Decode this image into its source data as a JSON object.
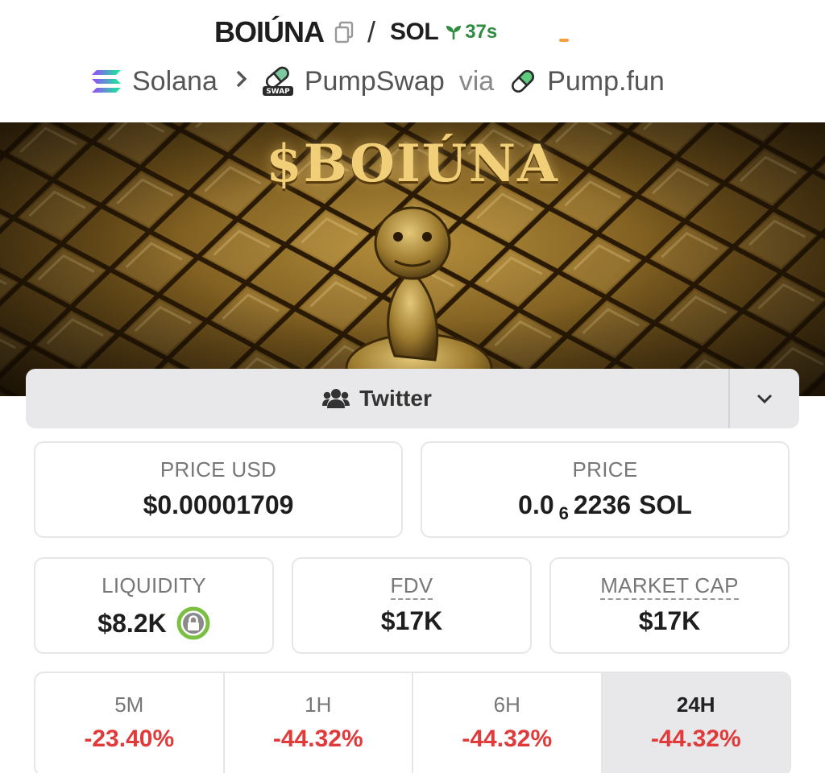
{
  "header": {
    "token_name": "BOIÚNA",
    "separator": "/",
    "quote_token": "SOL",
    "age": "37s"
  },
  "breadcrumb": {
    "chain": "Solana",
    "dex": "PumpSwap",
    "via": "via",
    "launchpad": "Pump.fun"
  },
  "banner": {
    "title": "$BOIÚNA"
  },
  "social": {
    "label": "Twitter"
  },
  "stats": {
    "price_usd": {
      "label": "PRICE USD",
      "value": "$0.00001709"
    },
    "price_native": {
      "label": "PRICE",
      "prefix": "0.0",
      "zeros": "6",
      "digits": "2236",
      "unit": "SOL"
    },
    "liquidity": {
      "label": "LIQUIDITY",
      "value": "$8.2K"
    },
    "fdv": {
      "label": "FDV",
      "value": "$17K"
    },
    "market_cap": {
      "label": "MARKET CAP",
      "value": "$17K"
    }
  },
  "changes": [
    {
      "label": "5M",
      "value": "-23.40%"
    },
    {
      "label": "1H",
      "value": "-44.32%"
    },
    {
      "label": "6H",
      "value": "-44.32%"
    },
    {
      "label": "24H",
      "value": "-44.32%",
      "active": true
    }
  ],
  "colors": {
    "negative": "#e03a3a",
    "age_green": "#2e8b3f",
    "lock_ring": "#7cc043",
    "banner_gold": "#f1cf78"
  },
  "icons": {
    "copy": "copy-icon",
    "age": "seedling-icon",
    "chain": "solana-icon",
    "dex": "swap-pill-icon",
    "launchpad": "pill-icon",
    "social": "users-icon",
    "dropdown": "chevron-down-icon",
    "liquidity_lock": "lock-icon"
  }
}
